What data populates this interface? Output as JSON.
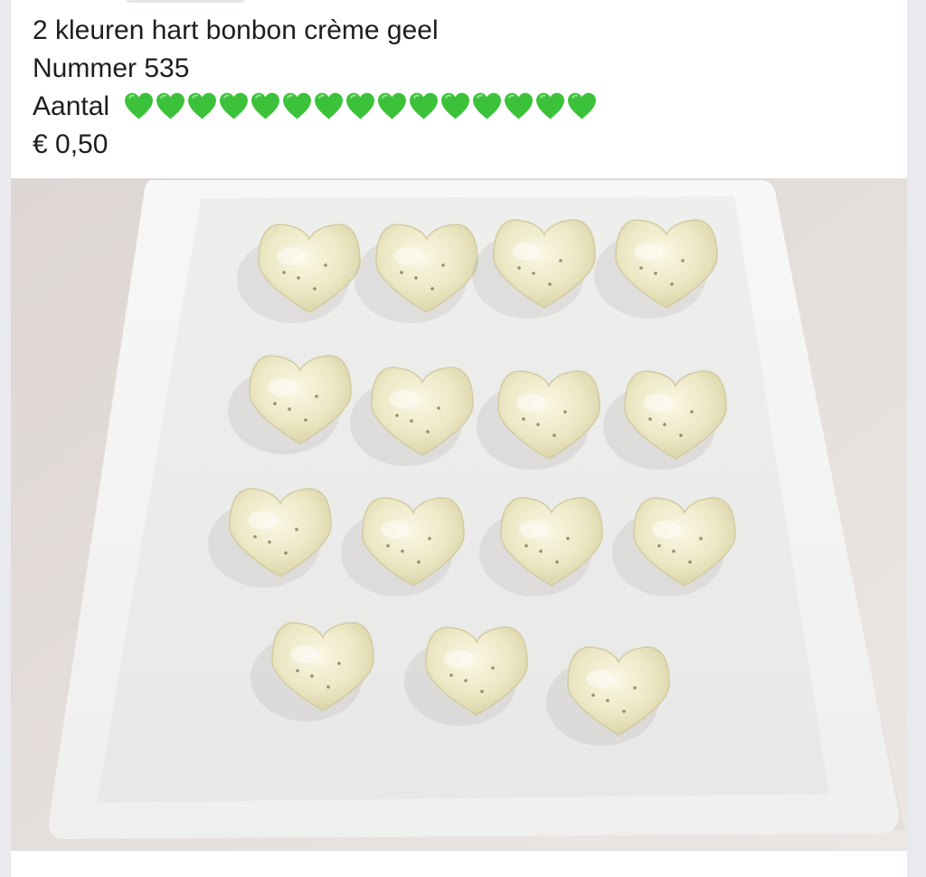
{
  "post": {
    "title": "2 kleuren hart bonbon crème geel",
    "number_line": "Nummer 535",
    "quantity_label": "Aantal",
    "quantity_hearts": 15,
    "heart_color": "#3cc23a",
    "price": "€ 0,50"
  },
  "photo": {
    "subject": "white-square-plate-with-heart-bonbons",
    "bonbon_rows": [
      4,
      4,
      4,
      3
    ],
    "plate_color": "#f4f3f1",
    "table_color": "#e4dedc",
    "bonbon_color": "#ece6c0"
  }
}
